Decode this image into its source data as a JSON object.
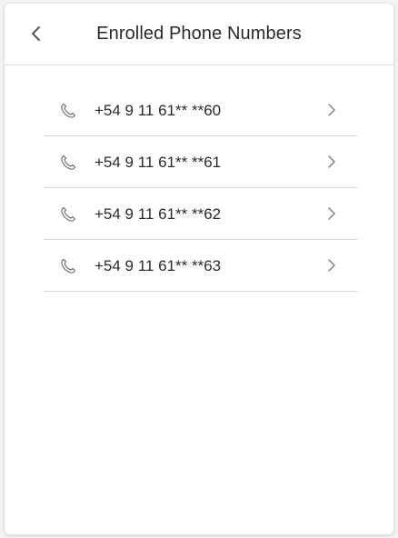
{
  "header": {
    "title": "Enrolled Phone Numbers",
    "back_icon": "chevron-left-icon"
  },
  "phones": [
    {
      "number": "+54 9 11 61** **60",
      "icon": "phone-icon"
    },
    {
      "number": "+54 9 11 61** **61",
      "icon": "phone-icon"
    },
    {
      "number": "+54 9 11 61** **62",
      "icon": "phone-icon"
    },
    {
      "number": "+54 9 11 61** **63",
      "icon": "phone-icon"
    }
  ],
  "colors": {
    "text": "#2a2a2a",
    "divider": "#d6d6d6",
    "icon": "#666666"
  }
}
